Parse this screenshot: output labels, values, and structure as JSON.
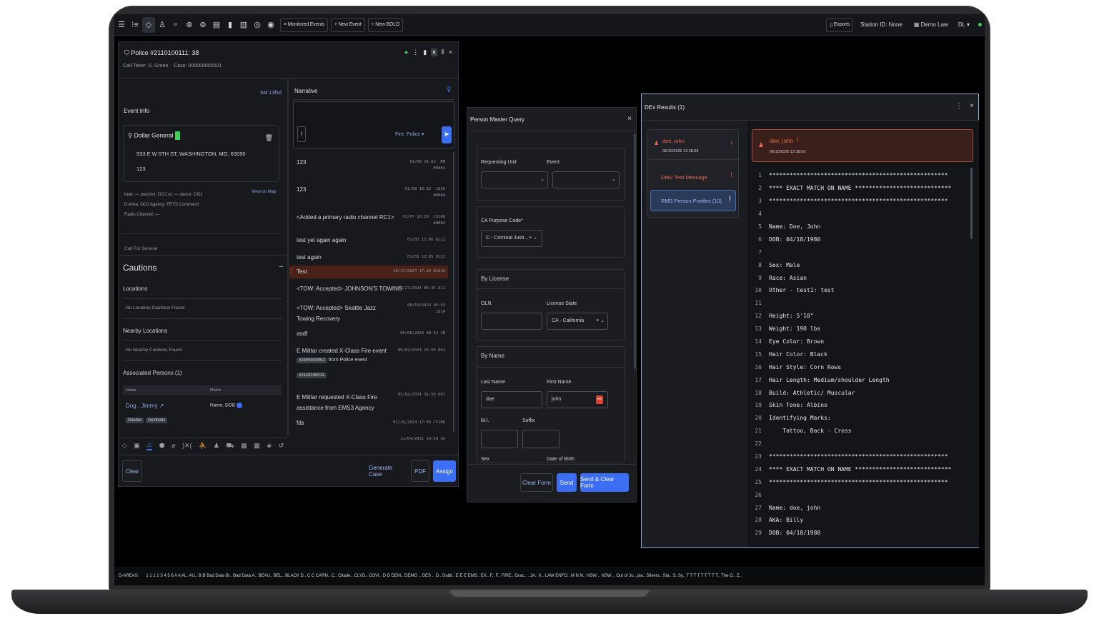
{
  "toolbar": {
    "monitored_events": "Monitored Events",
    "new_event": "New Event",
    "new_bolo": "New BOLO",
    "exports": "Exports",
    "station": "Station ID: None",
    "agency": "Demo Law",
    "user": "DL"
  },
  "event": {
    "title": "Police #2110100111: 38",
    "call_taker": "Call-Taker: S. Green",
    "case": "Case: 000000000001",
    "sm": "SM:13f5d",
    "section": "Event Info",
    "loc_name": "Dollar General",
    "address": "533 E W 5TH ST, WASHINGTON, MO, 63090",
    "addr2": "123",
    "beat": "beat: —   precinct: OOJ   ra: —   sector: OOJ",
    "darea": "D-Area: OOJ   Agency: FETS Command",
    "radio": "Radio Channel: —",
    "view_map": "View on Map",
    "cfs": "Call For Service"
  },
  "cautions": {
    "title": "Cautions",
    "locations": "Locations",
    "no_loc": "No Location Cautions Found",
    "nearby": "Nearby Locations",
    "no_nearby": "No Nearby Cautions Found",
    "assoc": "Associated Persons (1)",
    "col_name": "Name",
    "col_match": "Match",
    "person": "Dog , Jimmy",
    "match": "Name, DOB",
    "tag1": "Dasher",
    "tag2": "Alcoholic"
  },
  "narrative": {
    "title": "Narrative",
    "dest": "Fire, Police",
    "entries": [
      {
        "text": "123",
        "time": "01/08 16:02  RM\n#0884"
      },
      {
        "text": "123",
        "time": "01/08 16:02  181A\n#0884"
      },
      {
        "text": "<Added a primary radio channel RC1>",
        "time": "01/07 16:29  CS106\n#0884"
      },
      {
        "text": "test yet again again",
        "time": "01/03 12:06  B122"
      },
      {
        "text": "test again",
        "time": "01/03 12:05  B122"
      },
      {
        "text": "Test",
        "time": "10/17/2024 17:38  B181A"
      },
      {
        "text": "<TOW: Accepted> JOHNSON'S TOWING",
        "time": "08/27/2024 06:43  A11"
      },
      {
        "text": "<TOW: Accepted> Seattle Jazz Towing Recovery",
        "time": "08/15/2024 06:43  181A"
      },
      {
        "text": "asdf",
        "time": "05/08/2024 08:33  JB"
      },
      {
        "text": "E Militar created X-Class Fire event",
        "time": "05/02/2024 16:50  601"
      },
      {
        "text": "E Militar requested X-Class Fire assistance from EMS3 Agency",
        "time": "05/02/2024 16:50  601"
      },
      {
        "text": "fds",
        "time": "02/26/2024 17:48  CS106"
      },
      {
        "text": "",
        "time": "11/04/2021 14:38  SG"
      }
    ],
    "tag1": "#2405020002",
    "from": "from Police event",
    "tag2": "#2110100011"
  },
  "footer": {
    "clear": "Clear",
    "gen_case": "Generate Case",
    "pdf": "PDF",
    "assign": "Assign"
  },
  "pmq": {
    "title": "Person Master Query",
    "req_unit": "Requesting Unit",
    "event": "Event",
    "purpose": "CA Purpose Code*",
    "purpose_val": "C - Criminal Justi...",
    "by_license": "By License",
    "oln": "OLN",
    "lic_state": "License State",
    "lic_state_val": "CA - California",
    "by_name": "By Name",
    "last": "Last Name",
    "last_val": "doe",
    "first": "First Name",
    "first_val": "john",
    "mi": "M.I.",
    "suffix": "Suffix",
    "sex": "Sex",
    "dob": "Date of Birth",
    "clear": "Clear Form",
    "send": "Send",
    "send_clear": "Send & Clear Form"
  },
  "dex": {
    "title": "DEx Results (1)",
    "result_name": "doe, john",
    "result_time": "06/10/2025 12:28:03",
    "msg1": "DMV Test Message",
    "msg2": "RMS Person Profiles (10)",
    "lines": [
      "****************************************************",
      "**** EXACT MATCH ON NAME ****************************",
      "****************************************************",
      "",
      "Name: Doe, John",
      "DOB: 04/18/1980",
      "",
      "Sex: Male",
      "Race: Asian",
      "Other - test1: test",
      "",
      "Height: 5'10\"",
      "Weight: 190 lbs",
      "Eye Color: Brown",
      "Hair Color: Black",
      "Hair Style: Corn Rows",
      "Hair Length: Medium/shoulder Length",
      "Build: Athletic/ Muscular",
      "Skin Tone: Albino",
      "Identifying Marks:",
      "    Tattoo, Back - Cross",
      "",
      "****************************************************",
      "**** EXACT MATCH ON NAME ****************************",
      "****************************************************",
      "",
      "Name: doe, john",
      "AKA: Billy",
      "DOB: 04/18/1980"
    ]
  },
  "status": {
    "label": "D-AREAS:",
    "items": "1 1 1 2 3 4 5 6 A A AL.   AU..   B  B  Bad Data Bl..   Bad Data A..   BEAU..   BEL..   BLACK D..   C  C  CARN..   C..   Citade..   CLYD..   COVI..   D  D  DEM..   DEMO ..   DES ..   D..   Dubli..   E  E  E  EMS..   EX..   F..   F..   FIRE..   Grac..   .  JA..   K..   LAW ENFO..   M  N  N..   NSW ..   NSW ..   Out of Ju..   pla..   Silvers..   Sta..   S.  Sy..   T  T  T  T  T  T  T  T  T..   The O..   Z.."
  }
}
